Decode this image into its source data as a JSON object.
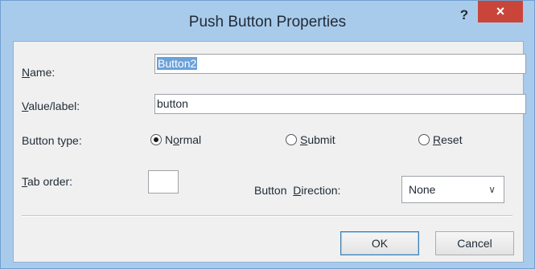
{
  "window": {
    "title": "Push Button Properties",
    "help_glyph": "?",
    "close_glyph": "×"
  },
  "form": {
    "name": {
      "label_prefix": "",
      "label_accel": "N",
      "label_rest": "ame:",
      "value": "Button2"
    },
    "value_label": {
      "label_prefix": "",
      "label_accel": "V",
      "label_rest": "alue/label:",
      "value": "button"
    },
    "button_type": {
      "label": "Button type:",
      "options": [
        {
          "prefix": "N",
          "accel": "o",
          "rest": "rmal",
          "checked": true
        },
        {
          "prefix": "",
          "accel": "S",
          "rest": "ubmit",
          "checked": false
        },
        {
          "prefix": "",
          "accel": "R",
          "rest": "eset",
          "checked": false
        }
      ]
    },
    "tab_order": {
      "label_prefix": "",
      "label_accel": "T",
      "label_rest": "ab order:",
      "value": ""
    },
    "button_direction": {
      "label_prefix": "Button  ",
      "label_accel": "D",
      "label_rest": "irection:",
      "selected": "None",
      "chevron": "∨"
    }
  },
  "buttons": {
    "ok": "OK",
    "cancel": "Cancel"
  },
  "colors": {
    "frame": "#a9cbeb",
    "client_bg": "#f0f0f0",
    "close_red": "#c9453a",
    "selection": "#6aa1d9"
  }
}
